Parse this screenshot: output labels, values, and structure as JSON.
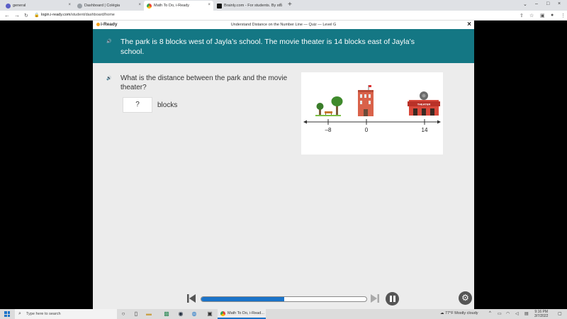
{
  "browser": {
    "tabs": [
      {
        "label": "general",
        "icon": "video-chat-icon",
        "color": "#5b5fc7",
        "active": false
      },
      {
        "label": "Dashboard | Colégia",
        "icon": "generic-site-icon",
        "color": "#9aa0a6",
        "active": false
      },
      {
        "label": "Math To Do, i-Ready",
        "icon": "chrome-icon",
        "color": "#34a853",
        "active": true
      },
      {
        "label": "Brainly.com - For students. By stu",
        "icon": "brainly-icon",
        "color": "#111111",
        "active": false
      }
    ],
    "tab_close": "×",
    "new_tab": "+",
    "window_controls": {
      "minimize": "–",
      "maximize": "□",
      "close": "×"
    },
    "nav": {
      "back": "←",
      "forward": "→",
      "reload": "C"
    },
    "url_host": "login.i-ready.com",
    "url_path": "/student/dashboard/home"
  },
  "quiz": {
    "logo": "i-Ready",
    "title": "Understand Distance on the Number Line — Quiz — Level G",
    "close": "×",
    "prompt": "The park is 8 blocks west of Jayla’s school. The movie theater is 14 blocks east of Jayla’s school.",
    "question": "What is the distance between the park and the movie theater?",
    "answer_value": "?",
    "answer_unit": "blocks",
    "progress_fraction": 0.5,
    "accent_color": "#147784",
    "progress_color": "#1a73c9"
  },
  "figure": {
    "tick_labels": [
      "–8",
      "0",
      "14"
    ],
    "theater_sign": "THEATER"
  },
  "taskbar": {
    "search_placeholder": "Type here to search",
    "active_task": "Math To Do, i-Read...",
    "weather": "77°F  Mostly cloudy",
    "time": "9:16 PM",
    "date": "3/7/2022"
  }
}
